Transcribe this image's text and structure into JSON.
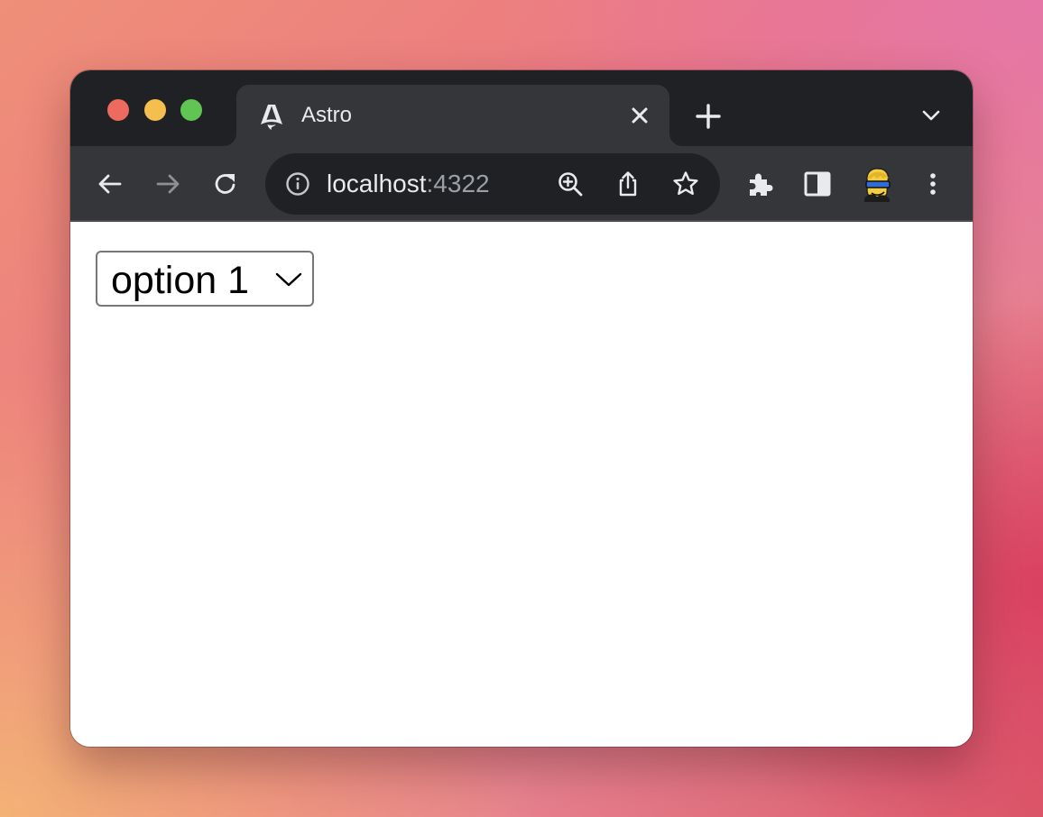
{
  "browser": {
    "tab": {
      "title": "Astro",
      "favicon": "astro-logo-icon",
      "close_icon": "close-icon"
    },
    "new_tab_icon": "plus-icon",
    "tab_search_icon": "chevron-down-icon",
    "toolbar": {
      "back_icon": "arrow-left-icon",
      "forward_icon": "arrow-right-icon",
      "reload_icon": "reload-icon",
      "extensions_icon": "puzzle-piece-icon",
      "side_panel_icon": "side-panel-icon",
      "profile_icon": "avatar",
      "menu_icon": "more-vertical-icon"
    },
    "omnibox": {
      "host": "localhost",
      "port": ":4322",
      "info_icon": "info-icon",
      "zoom_icon": "zoom-in-icon",
      "share_icon": "share-icon",
      "bookmark_icon": "star-icon"
    },
    "colors": {
      "frame": "#202124",
      "toolbar": "#35363a",
      "traffic_close": "#ed6a5e",
      "traffic_minimize": "#f5bf4f",
      "traffic_zoom": "#61c554"
    }
  },
  "page": {
    "select": {
      "selected": "option 1"
    }
  }
}
